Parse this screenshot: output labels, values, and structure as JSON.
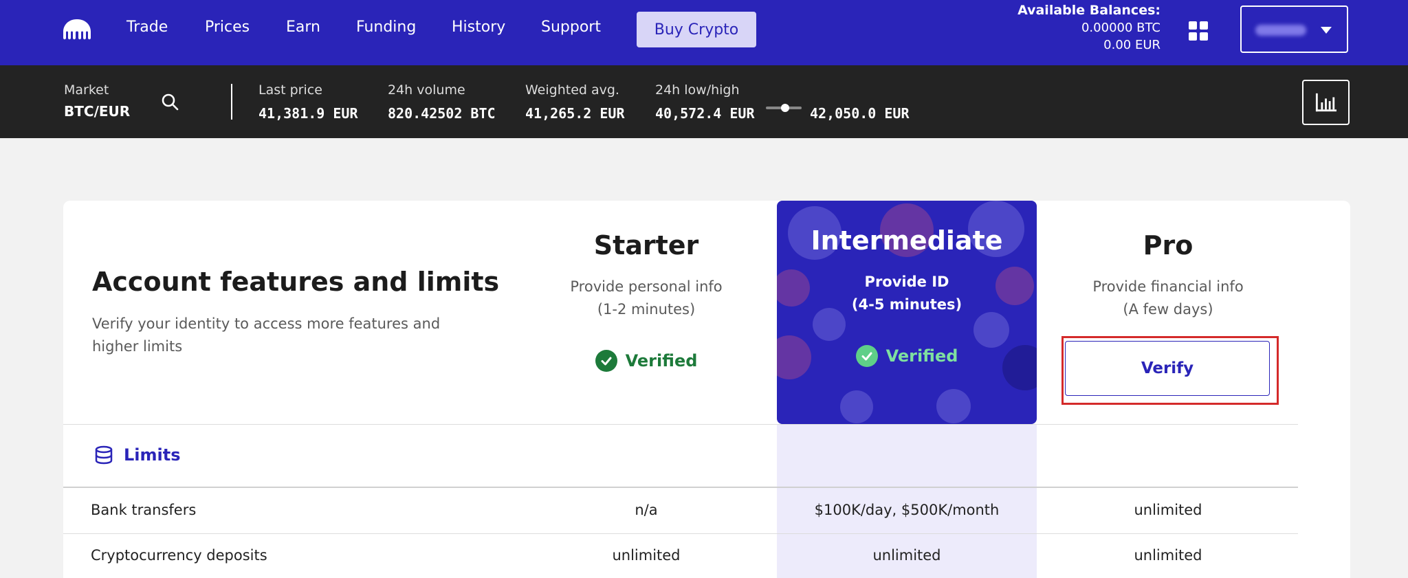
{
  "nav": {
    "items": [
      "Trade",
      "Prices",
      "Earn",
      "Funding",
      "History",
      "Support"
    ],
    "buy_label": "Buy Crypto",
    "balances_title": "Available Balances:",
    "balance_btc": "0.00000 BTC",
    "balance_eur": "0.00 EUR"
  },
  "market": {
    "market_label": "Market",
    "pair": "BTC/EUR",
    "last_price_label": "Last price",
    "last_price": "41,381.9 EUR",
    "volume_label": "24h volume",
    "volume": "820.42502 BTC",
    "wavg_label": "Weighted avg.",
    "wavg": "41,265.2 EUR",
    "lowhigh_label": "24h low/high",
    "low": "40,572.4 EUR",
    "high": "42,050.0 EUR"
  },
  "card": {
    "title": "Account features and limits",
    "subtitle": "Verify your identity to access more features and higher limits"
  },
  "tiers": {
    "starter": {
      "name": "Starter",
      "desc1": "Provide personal info",
      "desc2": "(1-2 minutes)",
      "status": "Verified"
    },
    "intermediate": {
      "name": "Intermediate",
      "desc1": "Provide ID",
      "desc2": "(4-5 minutes)",
      "status": "Verified"
    },
    "pro": {
      "name": "Pro",
      "desc1": "Provide financial info",
      "desc2": "(A few days)",
      "action": "Verify"
    }
  },
  "limits": {
    "section_label": "Limits",
    "rows": [
      {
        "label": "Bank transfers",
        "starter": "n/a",
        "intermediate": "$100K/day, $500K/month",
        "pro": "unlimited"
      },
      {
        "label": "Cryptocurrency deposits",
        "starter": "unlimited",
        "intermediate": "unlimited",
        "pro": "unlimited"
      }
    ]
  },
  "colors": {
    "brand": "#2a24b8",
    "verified": "#1d7a3a",
    "highlight": "#d42a2a"
  }
}
